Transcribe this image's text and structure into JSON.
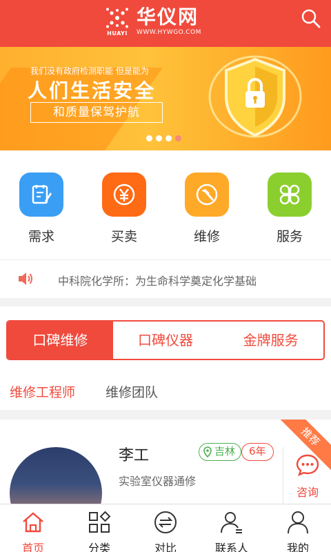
{
  "header": {
    "brand_mark": "HUAYI",
    "brand_title": "华仪网",
    "brand_url": "WWW.HYWGO.COM",
    "search_icon": "search-icon"
  },
  "banner": {
    "line1": "我们没有政府检测职能 但是能为",
    "line2": "人们生活安全",
    "line3": "和质量保驾护航",
    "slide_count": 4,
    "active_slide": 4
  },
  "categories": [
    {
      "label": "需求",
      "icon": "document-edit-icon",
      "color": "#3a9ef5"
    },
    {
      "label": "买卖",
      "icon": "yen-icon",
      "color": "#ff6a14"
    },
    {
      "label": "维修",
      "icon": "hammer-icon",
      "color": "#ffa928"
    },
    {
      "label": "服务",
      "icon": "grid-clover-icon",
      "color": "#8bcf2e"
    }
  ],
  "notice": {
    "icon": "speaker-icon",
    "text": "中科院化学所：为生命科学奠定化学基础"
  },
  "segments": {
    "items": [
      "口碑维修",
      "口碑仪器",
      "金牌服务"
    ],
    "active": 0
  },
  "sub_tabs": {
    "items": [
      "维修工程师",
      "维修团队"
    ],
    "active": 0
  },
  "engineer": {
    "name": "李工",
    "location": "吉林",
    "years": "6年",
    "desc": "实验室仪器通修",
    "consult_label": "咨询",
    "ribbon": "推荐"
  },
  "bottom_nav": {
    "items": [
      {
        "label": "首页",
        "icon": "home-icon"
      },
      {
        "label": "分类",
        "icon": "category-icon"
      },
      {
        "label": "对比",
        "icon": "compare-icon"
      },
      {
        "label": "联系人",
        "icon": "contacts-icon"
      },
      {
        "label": "我的",
        "icon": "profile-icon"
      }
    ],
    "active": 0
  },
  "colors": {
    "brand_red": "#f04a3c",
    "banner_orange": "#ffb02e",
    "location_green": "#4caf50"
  }
}
